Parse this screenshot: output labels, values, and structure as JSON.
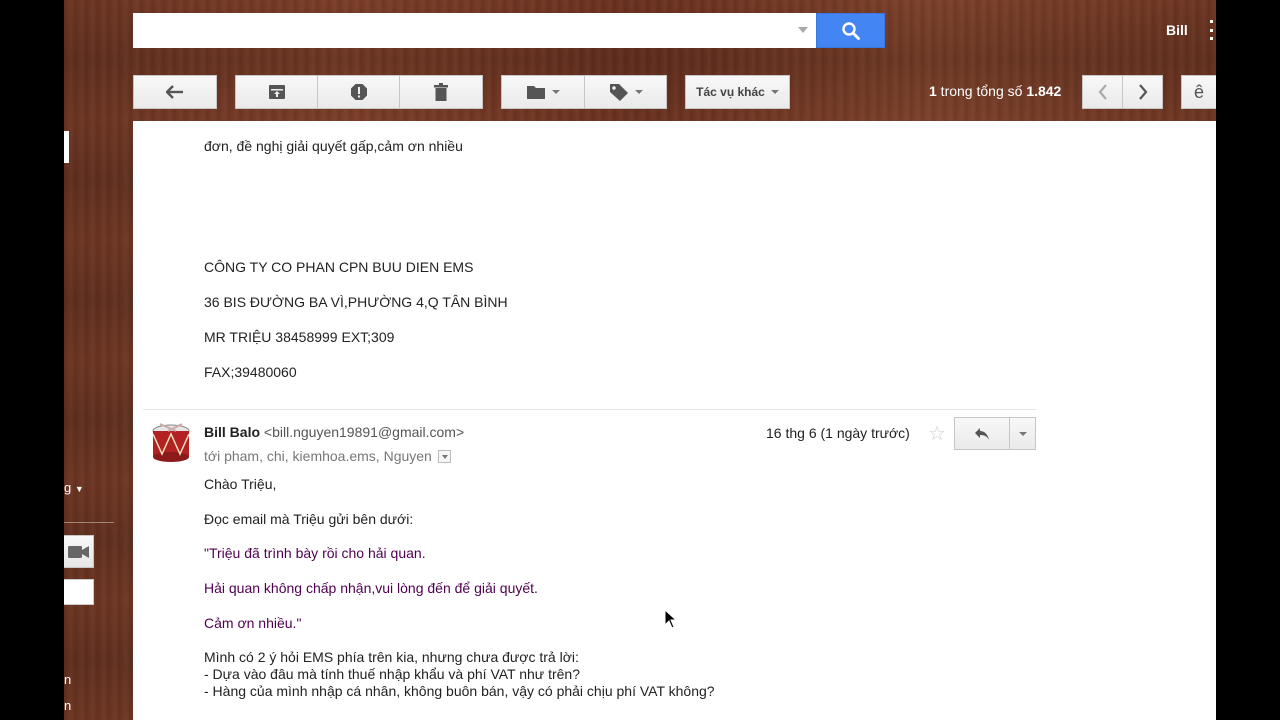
{
  "header": {
    "search": {
      "value": "",
      "placeholder": ""
    },
    "account_name": "Bill"
  },
  "toolbar": {
    "more_actions_label": "Tác vụ khác",
    "pagination": {
      "current": "1",
      "text_middle": " trong tổng số ",
      "total": "1.842"
    },
    "right_edge_label": "ê"
  },
  "prev_message": {
    "lines": [
      "đơn, đề nghị giải quyết gấp,cảm ơn nhiều",
      "CÔNG TY CO PHAN CPN BUU DIEN EMS",
      "36 BIS ĐƯỜNG BA VÌ,PHƯỜNG 4,Q TÂN BÌNH",
      "MR TRIỆU 38458999 EXT;309",
      "FAX;39480060"
    ]
  },
  "message": {
    "sender_name": "Bill Balo",
    "sender_email": "<bill.nguyen19891@gmail.com>",
    "recipients": "tới pham, chi, kiemhoa.ems, Nguyen",
    "date": "16 thg 6 (1 ngày trước)",
    "body": {
      "greeting": "Chào Triệu,",
      "intro": "Đọc email mà Triệu gửi bên dưới:",
      "quote_1": "\"Triệu đã trình bày rồi cho hải quan.",
      "quote_2": "Hải quan không chấp nhận,vui lòng đến để giải quyết.",
      "quote_3": "Cảm ơn nhiều.\"",
      "question_intro": "Mình có 2 ý hỏi EMS phía trên kia, nhưng chưa được trả lời:",
      "question_1": "- Dựa vào đâu mà tính thuế nhập khẩu và phí VAT như trên?",
      "question_2": "- Hàng của mình nhập cá nhân, không buôn bán, vậy có phải chịu phí VAT không?"
    }
  },
  "left_nav": {
    "frag_g": "g",
    "frag_n1": "n",
    "frag_n2": "n"
  },
  "colors": {
    "search_blue": "#4485f4",
    "quote_purple": "#500050"
  }
}
